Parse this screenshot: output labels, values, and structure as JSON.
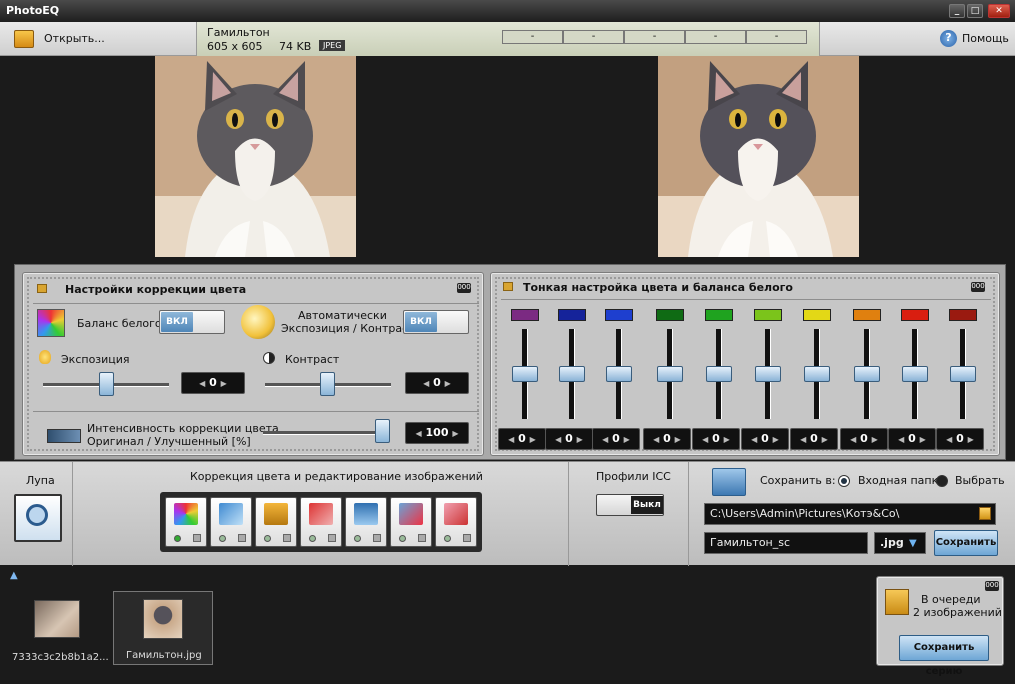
{
  "window": {
    "title": "PhotoEQ",
    "controls": [
      "_",
      "□",
      "✕"
    ]
  },
  "toolbar": {
    "open_label": "Открыть...",
    "help_label": "Помощь"
  },
  "file_info": {
    "name": "Гамильтон",
    "dimensions": "605 x 605",
    "size": "74 KB",
    "format": "JPEG",
    "status_boxes": [
      "-",
      "-",
      "-",
      "-",
      "-"
    ]
  },
  "color_panel": {
    "title": "Настройки коррекции цвета",
    "white_balance_label": "Баланс белого",
    "white_balance_toggle": "ВКЛ",
    "auto_label_line1": "Автоматически",
    "auto_label_line2": "Экспозиция / Контраст",
    "auto_toggle": "ВКЛ",
    "exposure_label": "Экспозиция",
    "exposure_value": "0",
    "exposure_level": 0.5,
    "contrast_label": "Контраст",
    "contrast_value": "0",
    "contrast_level": 0.5,
    "intensity_line1": "Интенсивность коррекции цвета",
    "intensity_line2": "Оригинал / Улучшенный [%]",
    "intensity_value": "100",
    "intensity_level": 1.0
  },
  "fine_panel": {
    "title": "Тонкая настройка цвета и баланса белого",
    "channels": [
      {
        "color": "#7b2a82",
        "value": "0"
      },
      {
        "color": "#15239a",
        "value": "0"
      },
      {
        "color": "#1e3fcf",
        "value": "0"
      },
      {
        "color": "#0f6b14",
        "value": "0"
      },
      {
        "color": "#1fa31f",
        "value": "0"
      },
      {
        "color": "#7bc41b",
        "value": "0"
      },
      {
        "color": "#e3d816",
        "value": "0"
      },
      {
        "color": "#e0800f",
        "value": "0"
      },
      {
        "color": "#d91e10",
        "value": "0"
      },
      {
        "color": "#9a1a10",
        "value": "0"
      }
    ]
  },
  "bottom": {
    "loupe_label": "Лупа",
    "tools_label": "Коррекция цвета и редактирование изображений",
    "icc_label": "Профили ICC",
    "icc_toggle": "Выкл",
    "save_in_label": "Сохранить в:",
    "input_folder_label": "Входная папка",
    "choose_label": "Выбрать",
    "path_value": "C:\\Users\\Admin\\Pictures\\Котэ&Co\\",
    "filename_value": "Гамильтон_sc",
    "ext_value": ".jpg",
    "save_button": "Сохранить"
  },
  "filmstrip": {
    "items": [
      {
        "label": "7333c3c2b8b1a2..."
      },
      {
        "label": "Гамильтон.jpg"
      }
    ],
    "queue_line1": "В очереди",
    "queue_line2": "2 изображений",
    "save_series_button": "Сохранить серию"
  },
  "colors": {
    "accent": "#5b93c6",
    "panel": "#c6c6c6",
    "dark": "#1b1b1b"
  }
}
